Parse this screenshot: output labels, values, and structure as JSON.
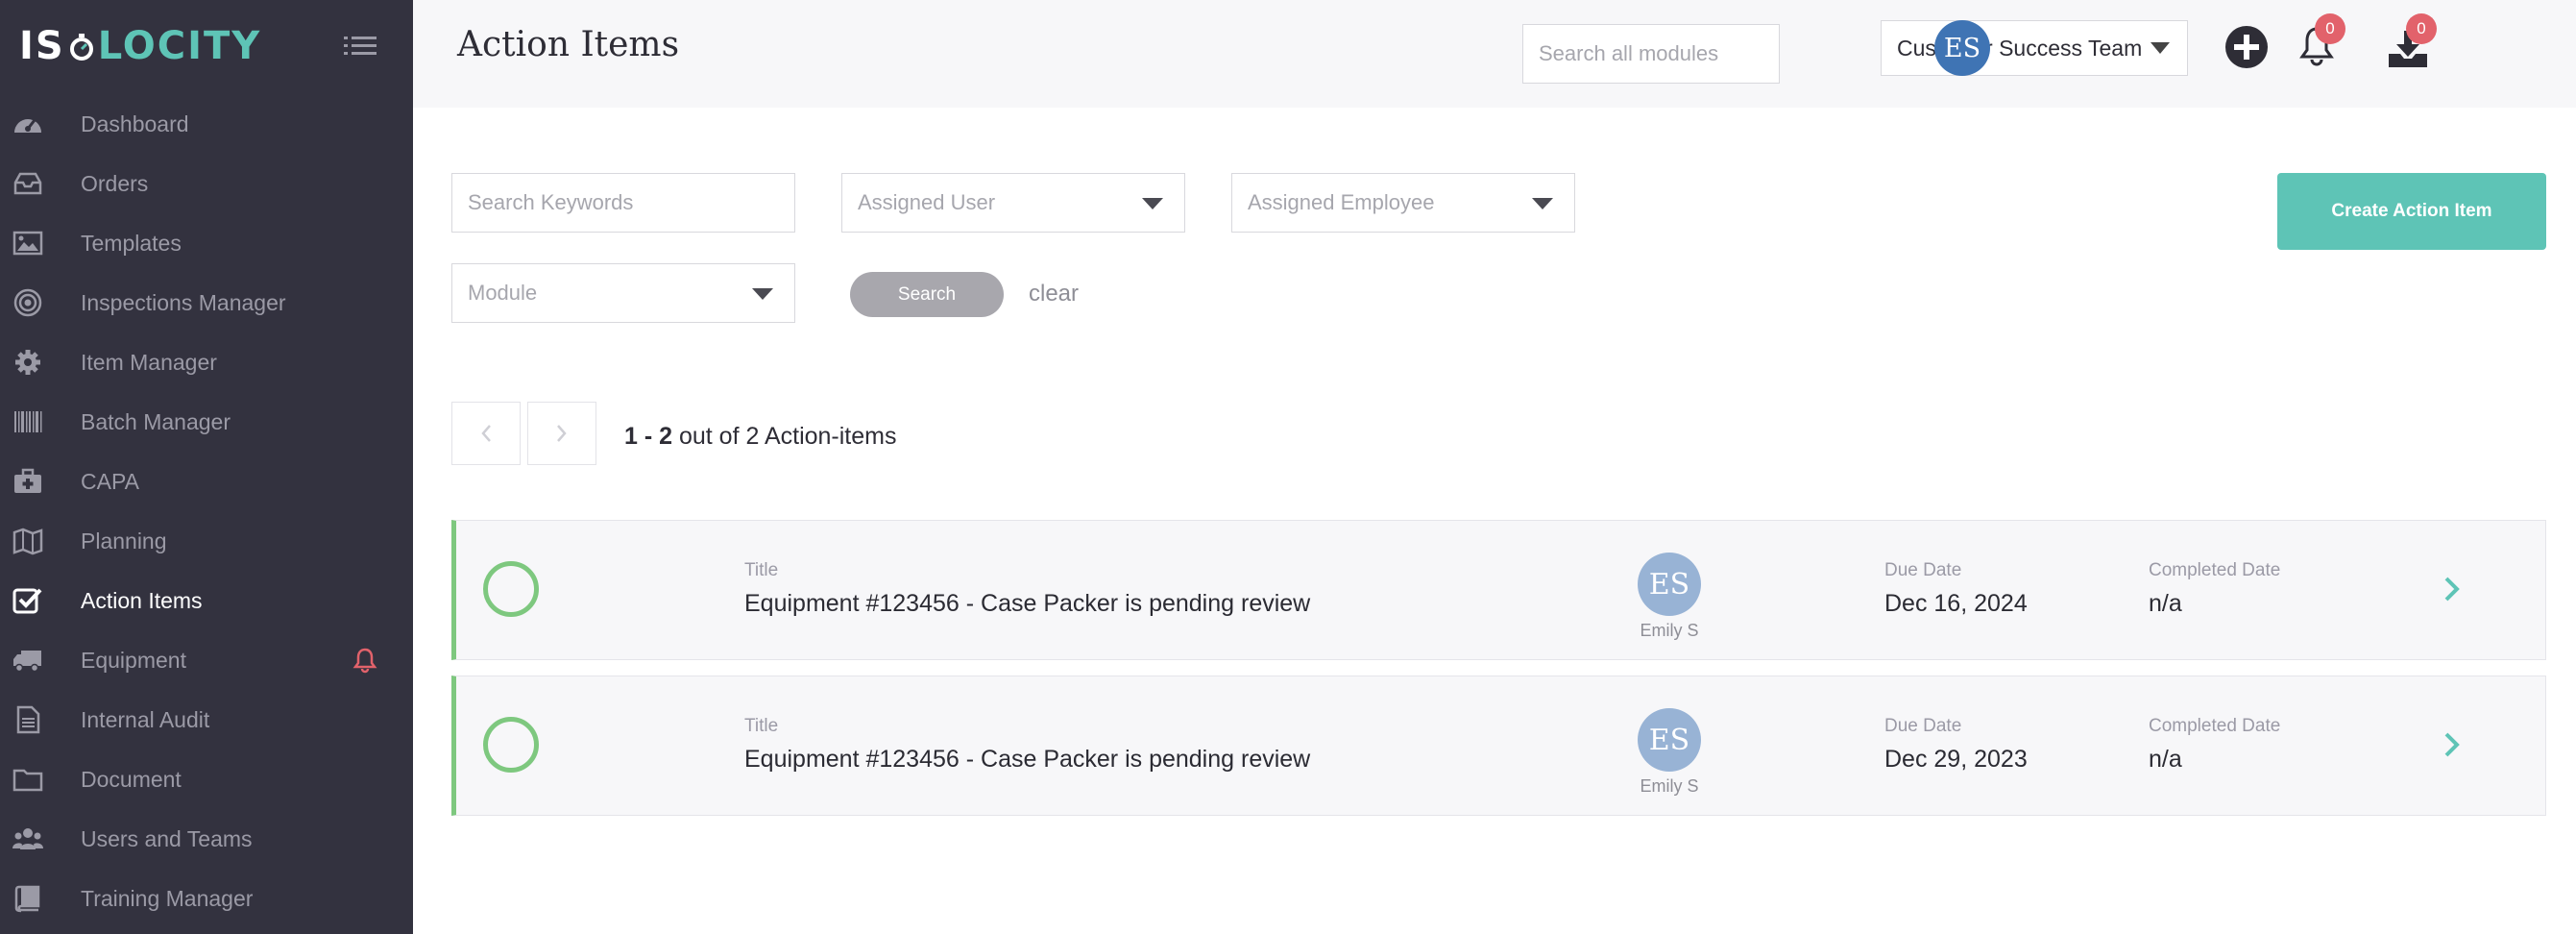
{
  "app": {
    "logo_left": "IS",
    "logo_right": "LOCITY"
  },
  "sidebar": {
    "items": [
      {
        "label": "Dashboard",
        "icon": "dashboard-gauge-icon",
        "active": false
      },
      {
        "label": "Orders",
        "icon": "inbox-tray-icon",
        "active": false
      },
      {
        "label": "Templates",
        "icon": "image-icon",
        "active": false
      },
      {
        "label": "Inspections Manager",
        "icon": "target-icon",
        "active": false
      },
      {
        "label": "Item Manager",
        "icon": "gear-icon",
        "active": false
      },
      {
        "label": "Batch Manager",
        "icon": "barcode-icon",
        "active": false
      },
      {
        "label": "CAPA",
        "icon": "medical-kit-icon",
        "active": false
      },
      {
        "label": "Planning",
        "icon": "map-icon",
        "active": false
      },
      {
        "label": "Action Items",
        "icon": "checked-box-icon",
        "active": true
      },
      {
        "label": "Equipment",
        "icon": "truck-icon",
        "active": false,
        "alert": true
      },
      {
        "label": "Internal Audit",
        "icon": "document-text-icon",
        "active": false
      },
      {
        "label": "Document",
        "icon": "folder-icon",
        "active": false
      },
      {
        "label": "Users and Teams",
        "icon": "users-icon",
        "active": false
      },
      {
        "label": "Training Manager",
        "icon": "book-icon",
        "active": false
      }
    ]
  },
  "header": {
    "title": "Action Items",
    "search_placeholder": "Search all modules",
    "team_selected": "Customer Success Team",
    "notifications_count": "0",
    "downloads_count": "0",
    "user_initials": "ES"
  },
  "filters": {
    "keywords_placeholder": "Search Keywords",
    "assigned_user_placeholder": "Assigned User",
    "assigned_employee_placeholder": "Assigned Employee",
    "module_placeholder": "Module",
    "search_label": "Search",
    "clear_label": "clear",
    "create_label": "Create Action Item"
  },
  "pagination": {
    "range": "1 - 2",
    "suffix": " out of 2 Action-items"
  },
  "columns": {
    "title": "Title",
    "due_date": "Due Date",
    "completed_date": "Completed Date"
  },
  "rows": [
    {
      "title": "Equipment #123456 - Case Packer is pending review",
      "assignee_initials": "ES",
      "assignee_name": "Emily S",
      "due_date": "Dec 16, 2024",
      "completed_date": "n/a"
    },
    {
      "title": "Equipment #123456 - Case Packer is pending review",
      "assignee_initials": "ES",
      "assignee_name": "Emily S",
      "due_date": "Dec 29, 2023",
      "completed_date": "n/a"
    }
  ],
  "colors": {
    "sidebar_bg": "#33323f",
    "accent_teal": "#5ec4b6",
    "status_green": "#7ec87f",
    "badge_red": "#e2626b",
    "alert_red": "#e2626b"
  }
}
